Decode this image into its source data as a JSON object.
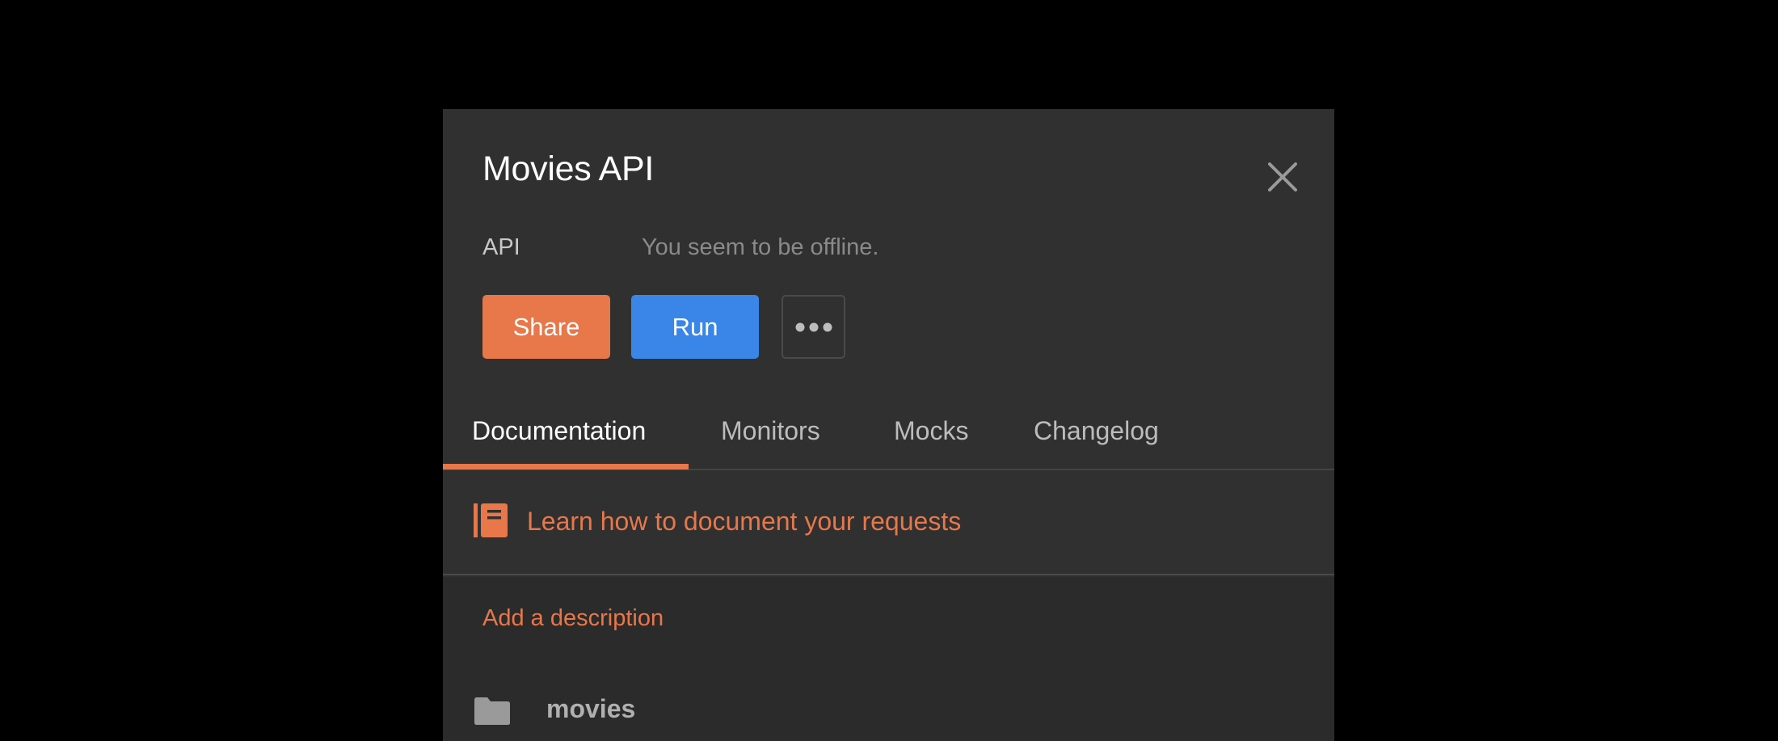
{
  "panel": {
    "title": "Movies API",
    "type_label": "API",
    "status_text": "You seem to be offline.",
    "buttons": {
      "share": "Share",
      "run": "Run",
      "more_icon": "ellipsis-icon"
    },
    "close_icon": "close-icon"
  },
  "tabs": [
    {
      "label": "Documentation",
      "active": true
    },
    {
      "label": "Monitors",
      "active": false
    },
    {
      "label": "Mocks",
      "active": false
    },
    {
      "label": "Changelog",
      "active": false
    }
  ],
  "documentation": {
    "learn_icon": "book-icon",
    "learn_link": "Learn how to document your requests",
    "add_description": "Add a description",
    "folders": [
      {
        "icon": "folder-icon",
        "name": "movies"
      }
    ]
  },
  "colors": {
    "accent": "#e8774a",
    "run": "#3a86e8",
    "panel_bg": "#303030",
    "page_bg": "#000000"
  }
}
